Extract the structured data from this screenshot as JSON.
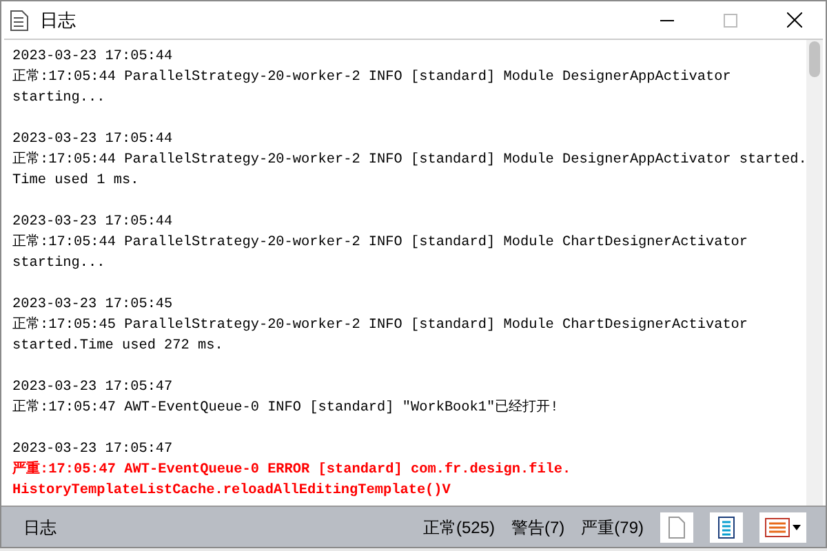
{
  "window": {
    "title": "日志"
  },
  "entries": [
    {
      "timestamp": "2023-03-23 17:05:44",
      "kind": "normal",
      "lines": [
        "正常:17:05:44 ParallelStrategy-20-worker-2 INFO [standard] Module DesignerAppActivator",
        "starting..."
      ]
    },
    {
      "timestamp": "2023-03-23 17:05:44",
      "kind": "normal",
      "lines": [
        "正常:17:05:44 ParallelStrategy-20-worker-2 INFO [standard] Module DesignerAppActivator started.",
        "Time used 1 ms."
      ]
    },
    {
      "timestamp": "2023-03-23 17:05:44",
      "kind": "normal",
      "lines": [
        "正常:17:05:44 ParallelStrategy-20-worker-2 INFO [standard] Module ChartDesignerActivator",
        "starting..."
      ]
    },
    {
      "timestamp": "2023-03-23 17:05:45",
      "kind": "normal",
      "lines": [
        "正常:17:05:45 ParallelStrategy-20-worker-2 INFO [standard] Module ChartDesignerActivator",
        "started.Time used 272 ms."
      ]
    },
    {
      "timestamp": "2023-03-23 17:05:47",
      "kind": "normal",
      "lines": [
        "正常:17:05:47 AWT-EventQueue-0 INFO [standard] \"WorkBook1\"已经打开!"
      ]
    },
    {
      "timestamp": "2023-03-23 17:05:47",
      "kind": "severe",
      "lines": [
        "严重:17:05:47 AWT-EventQueue-0 ERROR [standard] com.fr.design.file.",
        "HistoryTemplateListCache.reloadAllEditingTemplate()V"
      ]
    }
  ],
  "status_bar": {
    "label": "日志",
    "counts": [
      "正常(525)",
      "警告(7)",
      "严重(79)"
    ]
  }
}
